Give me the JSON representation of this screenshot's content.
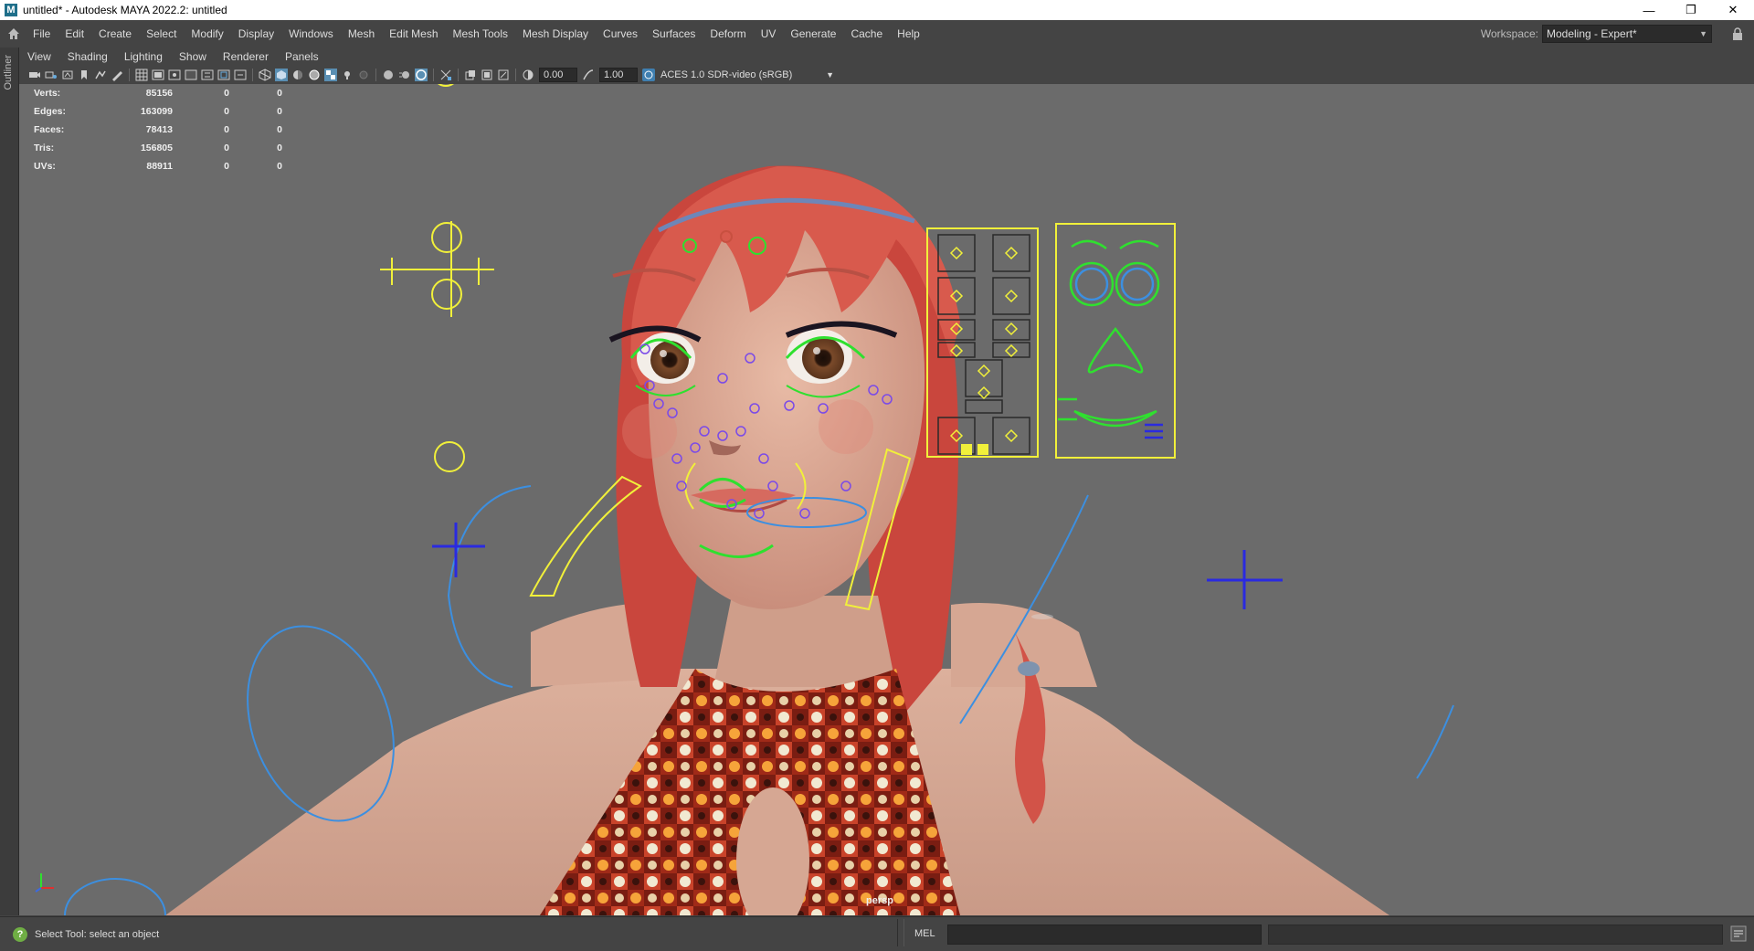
{
  "window": {
    "title": "untitled* - Autodesk MAYA 2022.2: untitled",
    "logo_letter": "M",
    "controls": {
      "minimize": "—",
      "restore": "❐",
      "close": "✕"
    }
  },
  "menubar": {
    "items": [
      "File",
      "Edit",
      "Create",
      "Select",
      "Modify",
      "Display",
      "Windows",
      "Mesh",
      "Edit Mesh",
      "Mesh Tools",
      "Mesh Display",
      "Curves",
      "Surfaces",
      "Deform",
      "UV",
      "Generate",
      "Cache",
      "Help"
    ],
    "workspace_label": "Workspace:",
    "workspace_value": "Modeling - Expert*"
  },
  "side": {
    "outliner_label": "Outliner"
  },
  "panel_menu": {
    "items": [
      "View",
      "Shading",
      "Lighting",
      "Show",
      "Renderer",
      "Panels"
    ]
  },
  "panel_toolbar": {
    "exposure": "0.00",
    "gamma": "1.00",
    "color_management": "ACES 1.0 SDR-video (sRGB)"
  },
  "hud": {
    "rows": [
      {
        "label": "Verts:",
        "value": "85156",
        "c1": "0",
        "c2": "0"
      },
      {
        "label": "Edges:",
        "value": "163099",
        "c1": "0",
        "c2": "0"
      },
      {
        "label": "Faces:",
        "value": "78413",
        "c1": "0",
        "c2": "0"
      },
      {
        "label": "Tris:",
        "value": "156805",
        "c1": "0",
        "c2": "0"
      },
      {
        "label": "UVs:",
        "value": "88911",
        "c1": "0",
        "c2": "0"
      }
    ]
  },
  "viewport": {
    "camera_label": "persp"
  },
  "statusbar": {
    "help_text": "Select Tool: select an object",
    "mel_label": "MEL"
  },
  "colors": {
    "ui_bg": "#444444",
    "viewport_bg": "#6b6b6b",
    "control_yellow": "#f1f03a",
    "control_green": "#2fe02f",
    "control_blue": "#3c8fe0",
    "control_navy": "#2a2ae0",
    "control_purple": "#7a4ae8",
    "hair": "#d7564a",
    "skin": "#d9a995"
  }
}
